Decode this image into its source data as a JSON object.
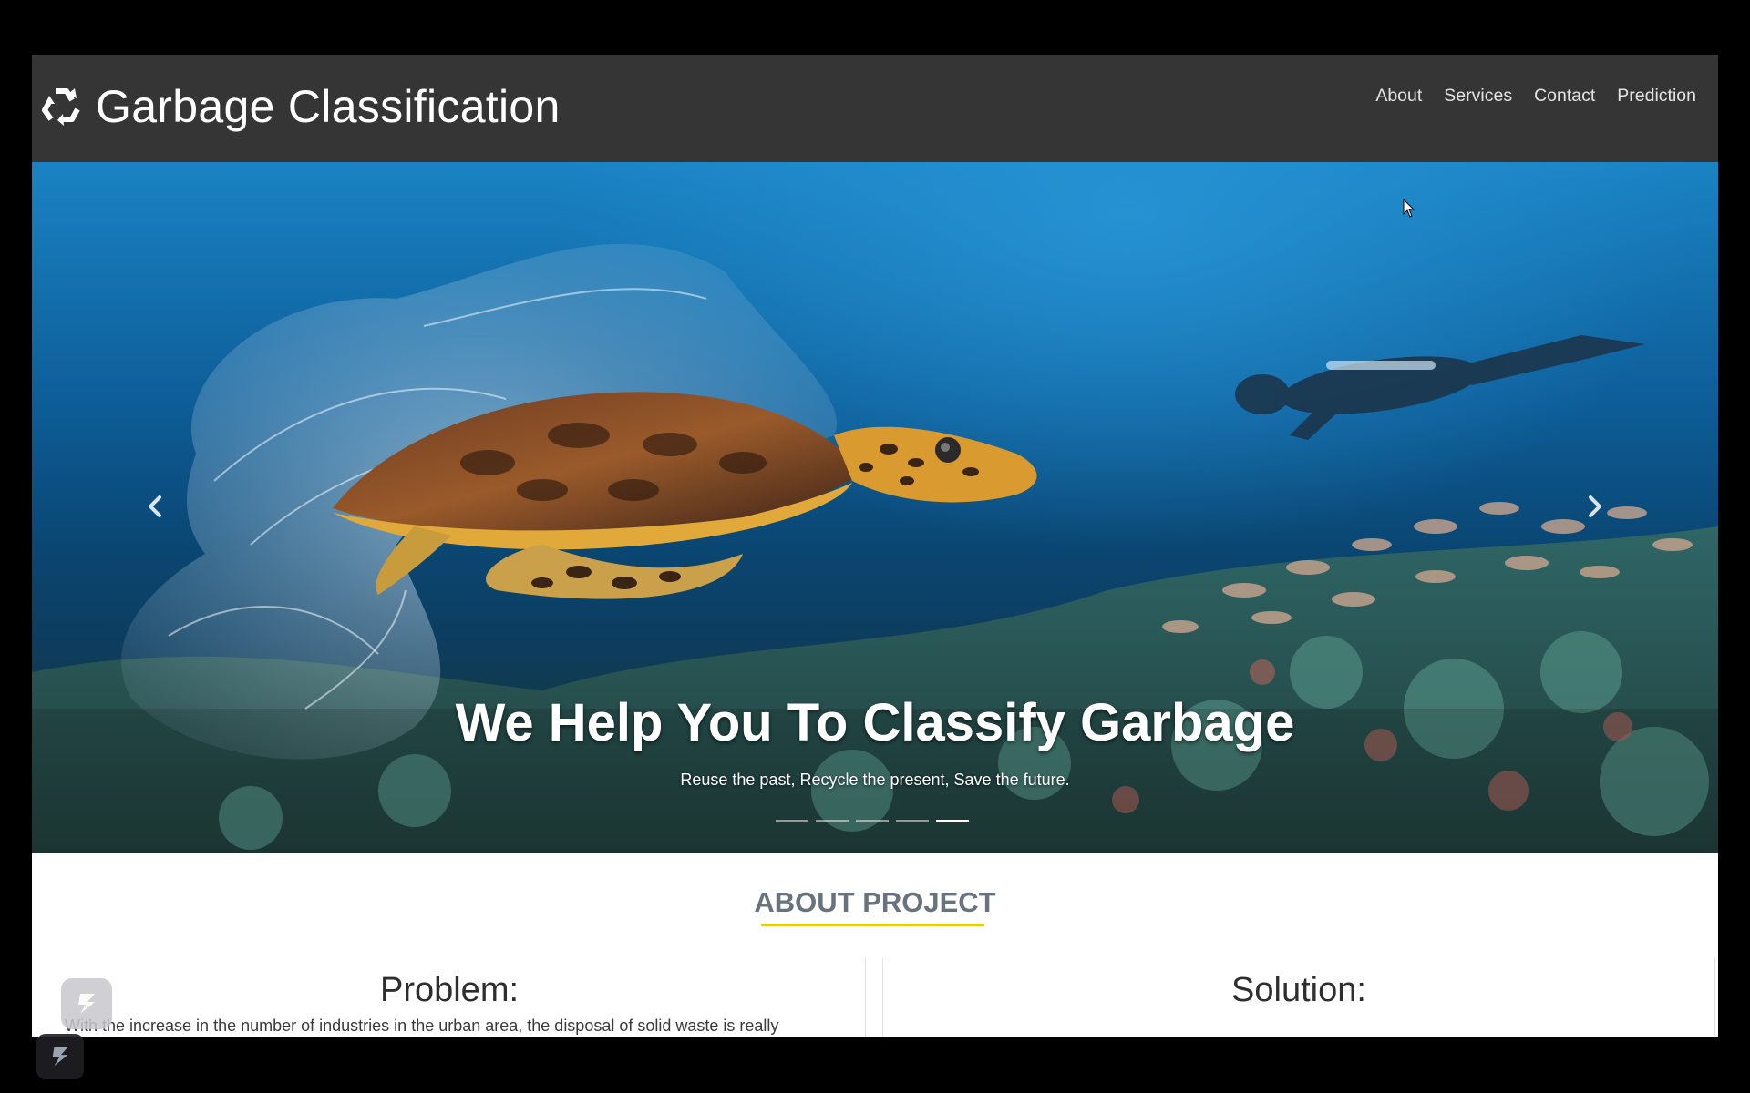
{
  "brand": {
    "title": "Garbage Classification",
    "icon": "recycle-icon"
  },
  "nav": {
    "items": [
      {
        "label": "About"
      },
      {
        "label": "Services"
      },
      {
        "label": "Contact"
      },
      {
        "label": "Prediction"
      }
    ]
  },
  "hero": {
    "title": "We Help You To Classify Garbage",
    "subtitle": "Reuse the past, Recycle the present, Save the future.",
    "slide_count": 5,
    "active_slide": 5,
    "prev_icon": "chevron-left-icon",
    "next_icon": "chevron-right-icon"
  },
  "about": {
    "heading": "ABOUT PROJECT",
    "problem_title": "Problem:",
    "problem_text": "With the increase in the number of industries in the urban area, the disposal of solid waste is really",
    "solution_title": "Solution:"
  },
  "colors": {
    "navbar": "#353535",
    "accent_underline": "#e6cb1c",
    "heading_gray": "#68737e"
  }
}
